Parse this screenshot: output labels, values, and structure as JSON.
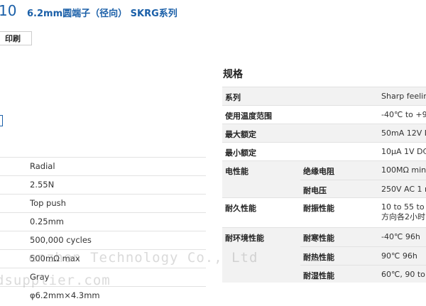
{
  "header": {
    "code": "10",
    "title": "6.2mm圆端子（径向） SKRG系列",
    "print_label": "印刷"
  },
  "left_specs": [
    "Radial",
    "2.55N",
    "Top push",
    "0.25mm",
    "500,000 cycles",
    "500mΩ max",
    "Gray",
    "φ6.2mm×4.3mm"
  ],
  "specs": {
    "title": "规格",
    "rows": [
      {
        "label": "系列",
        "sub": "",
        "value": "Sharp feelin"
      },
      {
        "label": "使用温度范围",
        "sub": "",
        "value": "-40℃ to +9"
      },
      {
        "label": "最大额定",
        "sub": "",
        "value": "50mA 12V D"
      },
      {
        "label": "最小额定",
        "sub": "",
        "value": "10μA 1V DC"
      },
      {
        "label": "电性能",
        "sub": "绝缘电阻",
        "value": "100MΩ min"
      },
      {
        "label": "",
        "sub": "耐电压",
        "value": "250V AC 1 m"
      },
      {
        "label": "耐久性能",
        "sub": "耐振性能",
        "value": "10 to 55 to",
        "value2": "方向各2小时"
      },
      {
        "label": "耐环境性能",
        "sub": "耐寒性能",
        "value": "-40℃ 96h"
      },
      {
        "label": "",
        "sub": "耐热性能",
        "value": "90℃ 96h"
      },
      {
        "label": "",
        "sub": "耐湿性能",
        "value": "60℃, 90 to"
      }
    ]
  },
  "watermark": {
    "line1": "enzhen Technology Co., Ltd",
    "line2": "dsupplier.com"
  }
}
